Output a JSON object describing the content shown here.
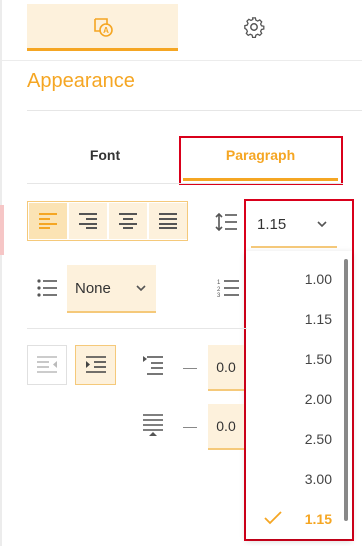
{
  "top_tabs": {
    "appearance_icon": "format-text-icon",
    "settings_icon": "gear-icon"
  },
  "section_title": "Appearance",
  "sub_tabs": {
    "font": "Font",
    "paragraph": "Paragraph"
  },
  "alignment": {
    "options": [
      "left",
      "right",
      "center",
      "justify"
    ],
    "selected": "left"
  },
  "line_spacing": {
    "value": "1.15",
    "options": [
      "1.00",
      "1.15",
      "1.50",
      "2.00",
      "2.50",
      "3.00",
      "1.15"
    ]
  },
  "list_style": {
    "value": "None"
  },
  "indent": {
    "left_value": "0.0",
    "right_value": "0.0"
  },
  "colors": {
    "accent": "#f5a623",
    "highlight_red": "#d9001b",
    "tint": "#fdf1dc"
  }
}
